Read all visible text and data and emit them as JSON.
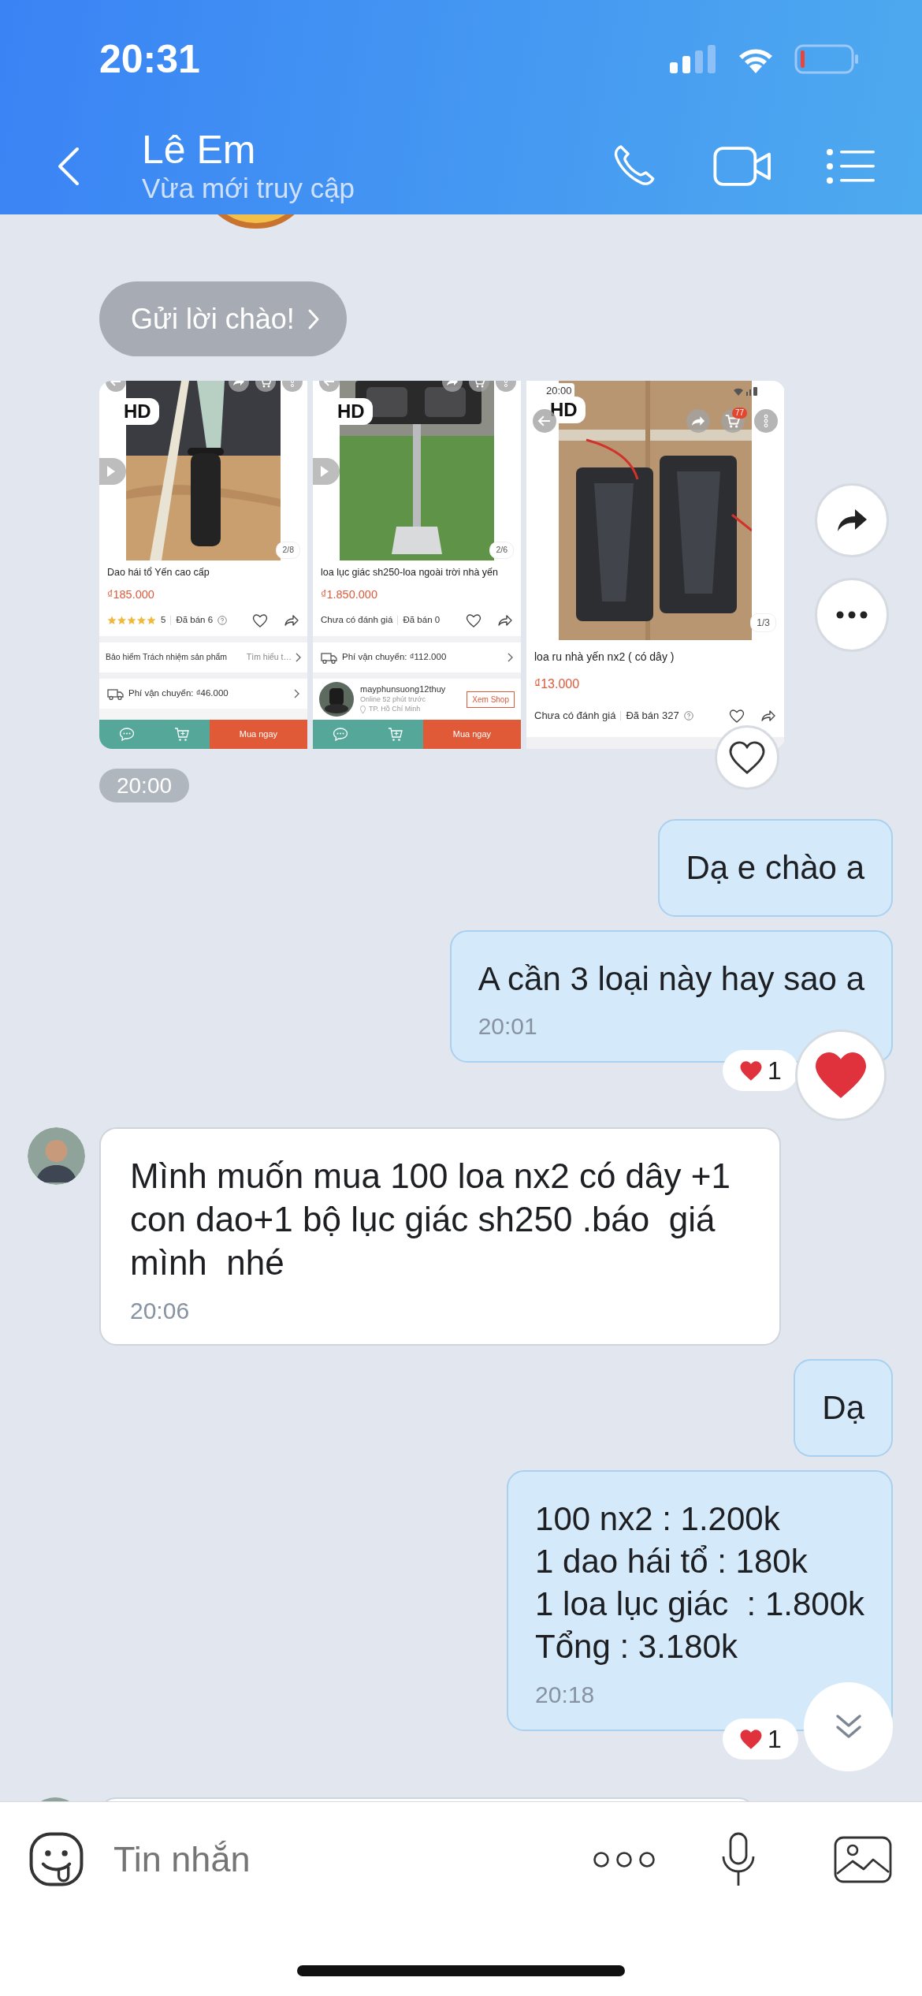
{
  "status_bar": {
    "time": "20:31"
  },
  "header": {
    "title": "Lê Em",
    "subtitle": "Vừa mới truy cập"
  },
  "greeting_button": "Gửi lời chào!",
  "shared_images": {
    "time": "20:00",
    "items": [
      {
        "kind": "compact",
        "video": true,
        "hd": "HD",
        "counter": "2/8",
        "title": "Dao hái tổ Yến cao cấp",
        "price": "₫185.000",
        "stars": 5,
        "score": "5",
        "sold": "Đã bán 6",
        "sold_help": true,
        "rows": [
          {
            "kind": "insurance",
            "label": "Bảo hiểm Trách nhiệm sản phẩm",
            "link": "Tìm hiểu t…"
          },
          {
            "kind": "shipping",
            "label": "Phí vận chuyển: ₫46.000"
          }
        ],
        "buy": "Mua ngay"
      },
      {
        "kind": "compact",
        "video": true,
        "hd": "HD",
        "counter": "2/6",
        "title": "loa lục giác sh250-loa ngoài trời nhà yến",
        "price": "₫1.850.000",
        "rating_text": "Chưa có đánh giá",
        "sold": "Đã bán 0",
        "sold_help": false,
        "rows": [
          {
            "kind": "shipping",
            "label": "Phí vận chuyển: ₫112.000"
          },
          {
            "kind": "seller",
            "name": "mayphunsuong12thuy",
            "online": "Online 52 phút trước",
            "location": "TP. Hồ Chí Minh",
            "button": "Xem Shop"
          }
        ],
        "buy": "Mua ngay"
      },
      {
        "kind": "large",
        "video": false,
        "status_time": "20:00",
        "hd": "HD",
        "cart_badge": "77",
        "counter": "1/3",
        "title": "loa ru nhà yến nx2 ( có dây )",
        "price": "₫13.000",
        "rating_text": "Chưa có đánh giá",
        "sold": "Đã bán 327",
        "sold_help": true
      }
    ]
  },
  "messages": [
    {
      "kind": "sent",
      "lines": [
        "Dạ e chào a"
      ]
    },
    {
      "kind": "sent",
      "lines": [
        "A cần 3 loại này hay sao a"
      ],
      "time": "20:01",
      "reaction": {
        "count": "1"
      },
      "quick_reaction": true
    },
    {
      "kind": "received",
      "lines": [
        "Mình muốn mua 100 loa nx2 có dây +1 con dao+1 bộ lục giác sh250 .báo  giá mình  nhé"
      ],
      "time": "20:06"
    },
    {
      "kind": "sent",
      "lines": [
        "Dạ"
      ]
    },
    {
      "kind": "sent",
      "lines": [
        "100 nx2 : 1.200k",
        "1 dao hái tổ : 180k",
        "1 loa lục giác  : 1.800k",
        "Tổng : 3.180k"
      ],
      "time": "20:18",
      "reaction": {
        "count": "1"
      },
      "quick_reaction": false
    }
  ],
  "composer": {
    "placeholder": "Tin nhắn"
  }
}
